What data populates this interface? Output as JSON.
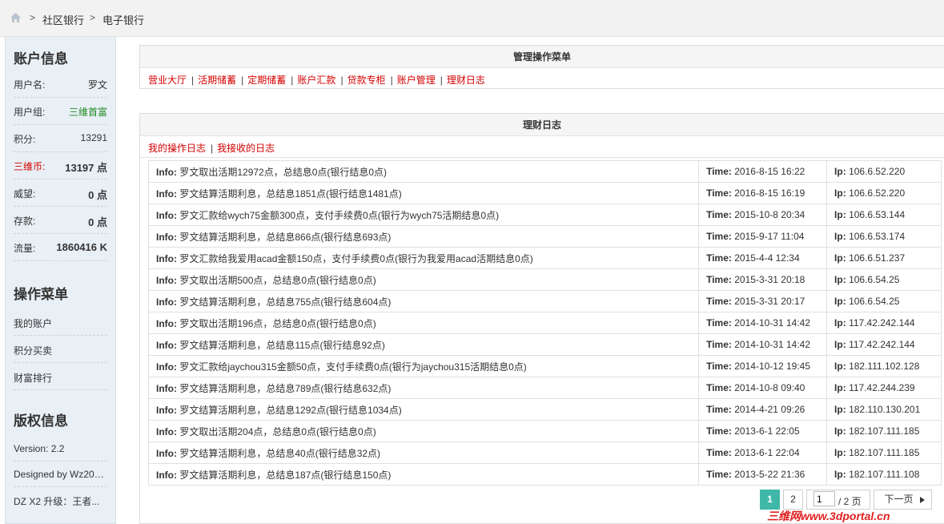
{
  "breadcrumb": {
    "items": [
      "社区银行",
      "电子银行"
    ],
    "separator": ">"
  },
  "sidebar": {
    "account_title": "账户信息",
    "account": [
      {
        "label": "用户名:",
        "value": "罗文"
      },
      {
        "label": "用户组:",
        "value": "三维首富"
      },
      {
        "label": "积分:",
        "value": "13291"
      },
      {
        "label": "三维币:",
        "value": "13197 点"
      },
      {
        "label": "威望:",
        "value": "0 点"
      },
      {
        "label": "存款:",
        "value": "0 点"
      },
      {
        "label": "流量:",
        "value": "1860416 K"
      }
    ],
    "menu_title": "操作菜单",
    "menu": [
      "我的账户",
      "积分买卖",
      "财富排行"
    ],
    "copyright_title": "版权信息",
    "copyright": [
      "Version: 2.2",
      "Designed by Wz200...",
      "DZ X2 升级：王者..."
    ]
  },
  "manage": {
    "title": "管理操作菜单",
    "links": [
      "营业大厅",
      "活期储蓄",
      "定期储蓄",
      "账户汇款",
      "贷款专柜",
      "账户管理",
      "理财日志"
    ]
  },
  "log": {
    "title": "理财日志",
    "tabs": [
      "我的操作日志",
      "我接收的日志"
    ],
    "labels": {
      "info": "Info:",
      "time": "Time:",
      "ip": "Ip:"
    },
    "rows": [
      {
        "info": "罗文取出活期12972点，总结息0点(银行结息0点)",
        "time": "2016-8-15 16:22",
        "ip": "106.6.52.220"
      },
      {
        "info": "罗文结算活期利息，总结息1851点(银行结息1481点)",
        "time": "2016-8-15 16:19",
        "ip": "106.6.52.220"
      },
      {
        "info": "罗文汇款给wych75金额300点，支付手续费0点(银行为wych75活期结息0点)",
        "time": "2015-10-8 20:34",
        "ip": "106.6.53.144"
      },
      {
        "info": "罗文结算活期利息，总结息866点(银行结息693点)",
        "time": "2015-9-17 11:04",
        "ip": "106.6.53.174"
      },
      {
        "info": "罗文汇款给我爱用acad金额150点，支付手续费0点(银行为我爱用acad活期结息0点)",
        "time": "2015-4-4 12:34",
        "ip": "106.6.51.237"
      },
      {
        "info": "罗文取出活期500点，总结息0点(银行结息0点)",
        "time": "2015-3-31 20:18",
        "ip": "106.6.54.25"
      },
      {
        "info": "罗文结算活期利息，总结息755点(银行结息604点)",
        "time": "2015-3-31 20:17",
        "ip": "106.6.54.25"
      },
      {
        "info": "罗文取出活期196点，总结息0点(银行结息0点)",
        "time": "2014-10-31 14:42",
        "ip": "117.42.242.144"
      },
      {
        "info": "罗文结算活期利息，总结息115点(银行结息92点)",
        "time": "2014-10-31 14:42",
        "ip": "117.42.242.144"
      },
      {
        "info": "罗文汇款给jaychou315金额50点，支付手续费0点(银行为jaychou315活期结息0点)",
        "time": "2014-10-12 19:45",
        "ip": "182.111.102.128"
      },
      {
        "info": "罗文结算活期利息，总结息789点(银行结息632点)",
        "time": "2014-10-8 09:40",
        "ip": "117.42.244.239"
      },
      {
        "info": "罗文结算活期利息，总结息1292点(银行结息1034点)",
        "time": "2014-4-21 09:26",
        "ip": "182.110.130.201"
      },
      {
        "info": "罗文取出活期204点，总结息0点(银行结息0点)",
        "time": "2013-6-1 22:05",
        "ip": "182.107.111.185"
      },
      {
        "info": "罗文结算活期利息，总结息40点(银行结息32点)",
        "time": "2013-6-1 22:04",
        "ip": "182.107.111.185"
      },
      {
        "info": "罗文结算活期利息，总结息187点(银行结息150点)",
        "time": "2013-5-22 21:36",
        "ip": "182.107.111.108"
      }
    ]
  },
  "pagination": {
    "pages": [
      "1",
      "2"
    ],
    "current": "1",
    "input_value": "1",
    "total": "/ 2 页",
    "next": "下一页"
  },
  "watermark": "三维网www.3dportal.cn",
  "colors": {
    "link_red": "#d40000",
    "group_green": "#1e8a1e",
    "page_active": "#3fb8a8",
    "sidebar_bg": "#e8eff5"
  }
}
